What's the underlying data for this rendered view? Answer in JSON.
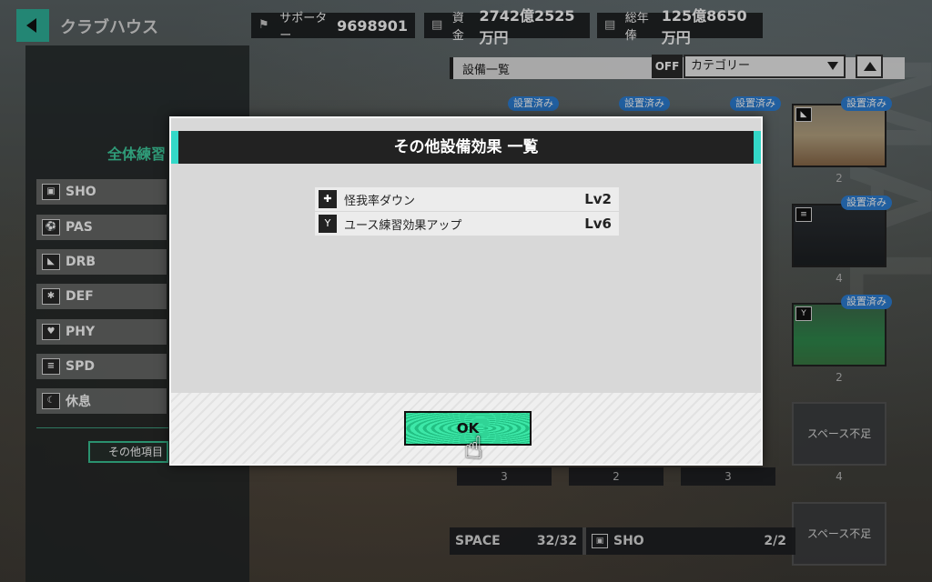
{
  "header": {
    "title": "クラブハウス",
    "supporters": {
      "label": "サポーター",
      "value": "9698901"
    },
    "funds": {
      "label": "資金",
      "value": "2742億2525万円"
    },
    "salary": {
      "label": "総年俸",
      "value": "125億8650万円"
    }
  },
  "left_panel": {
    "heading": "全体練習",
    "buttons": [
      {
        "label": "SHO",
        "icon": "shoot-icon"
      },
      {
        "label": "PAS",
        "icon": "pass-icon"
      },
      {
        "label": "DRB",
        "icon": "dribble-icon"
      },
      {
        "label": "DEF",
        "icon": "defense-icon"
      },
      {
        "label": "PHY",
        "icon": "physical-icon"
      },
      {
        "label": "SPD",
        "icon": "speed-icon"
      },
      {
        "label": "休息",
        "icon": "rest-icon"
      }
    ],
    "other_button": "その他項目"
  },
  "equipment": {
    "header": "設備一覧",
    "filter_toggle": "OFF",
    "category": "カテゴリー",
    "installed_badge": "設置済み",
    "space_short": "スペース不足",
    "card_counts": [
      "2",
      "4",
      "2",
      "4"
    ],
    "bottom_counts": [
      "3",
      "2",
      "3"
    ]
  },
  "space_bar": {
    "space_label": "SPACE",
    "space_value": "32/32",
    "sho_label": "SHO",
    "sho_value": "2/2"
  },
  "modal": {
    "title": "その他設備効果 一覧",
    "effects": [
      {
        "name": "怪我率ダウン",
        "level": "Lv2",
        "icon": "medical-spray-icon"
      },
      {
        "name": "ユース練習効果アップ",
        "level": "Lv6",
        "icon": "youth-icon"
      }
    ],
    "ok_label": "OK"
  },
  "colors": {
    "accent": "#2fb39b",
    "badge": "#2d7fd6",
    "modal_stripe": "#33d8c8"
  }
}
